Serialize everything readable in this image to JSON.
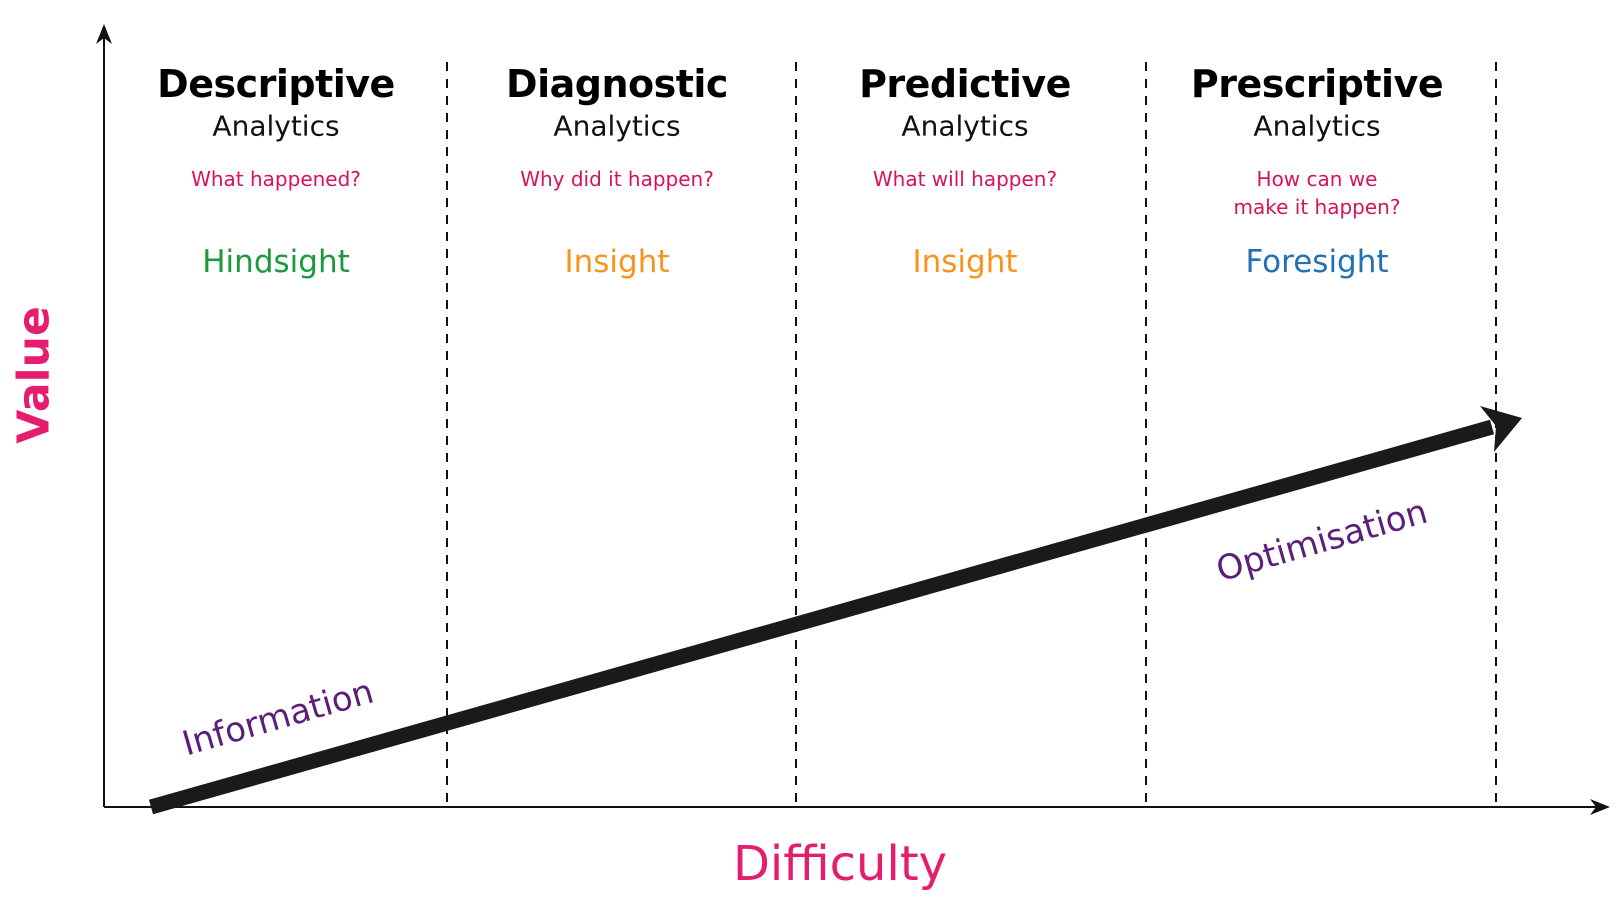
{
  "axes": {
    "x_label": "Difficulty",
    "y_label": "Value"
  },
  "columns": [
    {
      "title": "Descriptive",
      "subtitle": "Analytics",
      "question": "What happened?",
      "outcome": "Hindsight",
      "outcome_color": "#1a9a3c"
    },
    {
      "title": "Diagnostic",
      "subtitle": "Analytics",
      "question": "Why did it happen?",
      "outcome": "Insight",
      "outcome_color": "#f7941d"
    },
    {
      "title": "Predictive",
      "subtitle": "Analytics",
      "question": "What will happen?",
      "outcome": "Insight",
      "outcome_color": "#f7941d"
    },
    {
      "title": "Prescriptive",
      "subtitle": "Analytics",
      "question": "How can we make it happen?",
      "question_lines": [
        "How can we",
        "make it happen?"
      ],
      "outcome": "Foresight",
      "outcome_color": "#2271b3"
    }
  ],
  "arrow_labels": {
    "start": "Information",
    "end": "Optimisation"
  },
  "colors": {
    "axis_label": "#e41d6e",
    "question": "#d8125b",
    "arrow_label": "#5b1f7a"
  }
}
